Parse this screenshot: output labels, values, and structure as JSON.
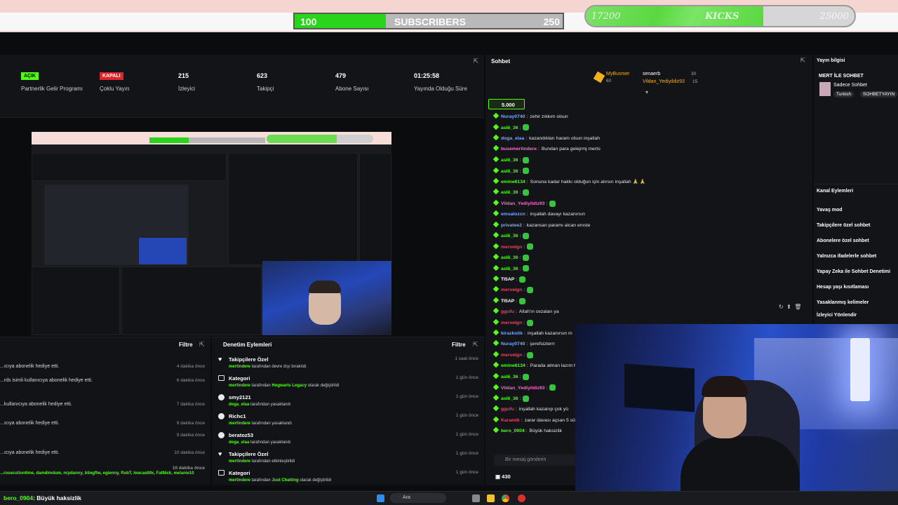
{
  "overlay": {
    "subscribers": {
      "label": "SUBSCRIBERS",
      "current": "100",
      "goal": "250",
      "progress": 0.34
    },
    "kicks": {
      "label": "KICKS",
      "current": "17200",
      "goal": "25000",
      "progress": 0.66
    }
  },
  "stats": [
    {
      "badge": "AÇIK",
      "badge_color": "#53fc18",
      "label": "Partnerlik Gelir Programı"
    },
    {
      "badge": "KAPALI",
      "badge_color": "#e0242b",
      "label": "Çoklu Yayın"
    },
    {
      "value": "215",
      "label": "İzleyici"
    },
    {
      "value": "623",
      "label": "Takipçi"
    },
    {
      "value": "479",
      "label": "Abone Sayısı"
    },
    {
      "value": "01:25:58",
      "label": "Yayında Olduğu Süre"
    }
  ],
  "events_panel": {
    "filter_label": "Filtre",
    "rows": [
      {
        "text": "...ıcıya abonelik hediye etti.",
        "time": "4 dakika önce"
      },
      {
        "text": "...rds isimli kullanıcıya abonelik hediye etti.",
        "time": "6 dakika önce"
      },
      {
        "text": "...kullanıcıya abonelik hediye etti.",
        "time": "7 dakika önce"
      },
      {
        "text": "...ıcıya abonelik hediye etti.",
        "time": "9 dakika önce"
      },
      {
        "text": "",
        "time": "9 dakika önce"
      },
      {
        "text": "...ıcıya abonelik hediye etti.",
        "time": "10 dakika önce"
      },
      {
        "text": "...rosecutiontime, damdimdum, nrpdanny, blingftw, egienny, RobT, loucas69x, FatNick, melanie10",
        "time": "10 dakika önce"
      }
    ]
  },
  "moderation_panel": {
    "title": "Denetim Eylemleri",
    "filter_label": "Filtre",
    "actions": [
      {
        "title": "Takipçilere Özel",
        "user": "mertindere",
        "rest": " tarafından devre dışı bırakıldı",
        "time": "1 saat önce"
      },
      {
        "title": "Kategori",
        "user": "mertindere",
        "mid": " tarafından ",
        "highlight": "Hogwarts Legacy",
        "rest": " olarak değiştirildi",
        "time": "1 gün önce"
      },
      {
        "title": "smy2121",
        "user": "doga_elaa",
        "rest": " tarafından yasaklandı",
        "time": "1 gün önce"
      },
      {
        "title": "Richc1",
        "user": "mertindere",
        "rest": " tarafından yasaklandı",
        "time": "1 gün önce"
      },
      {
        "title": "beratoz53",
        "user": "doga_elaa",
        "rest": " tarafından yasaklandı",
        "time": "1 gün önce"
      },
      {
        "title": "Takipçilere Özel",
        "user": "mertindere",
        "rest": " tarafından etkinleştirildi",
        "time": "1 gün önce"
      },
      {
        "title": "Kategori",
        "user": "mertindere",
        "mid": " tarafından ",
        "highlight": "Just Chatting",
        "rest": " olarak değiştirildi",
        "time": "1 gün önce"
      }
    ]
  },
  "chat": {
    "title": "Sohbet",
    "leaders": [
      {
        "name": "MyBusmer",
        "value": "60"
      },
      {
        "name": "senaerb",
        "value": "30"
      },
      {
        "name": "Vildan_Yediyildiz93",
        "value": "15"
      }
    ],
    "pinned_amount": "5.000",
    "messages": [
      {
        "user": "Nuray0740",
        "color": "#7aa8ff",
        "text": "zehir zıkkım olsun"
      },
      {
        "user": "aslii_36",
        "color": "#53fc18",
        "text": "",
        "emote": true
      },
      {
        "user": "doga_elaa",
        "color": "#7aa8ff",
        "text": "kazandıkları haram olsun inşallah"
      },
      {
        "user": "busemertindere",
        "color": "#ff6bd0",
        "text": "Bundan para gelejrmj merto"
      },
      {
        "user": "aslii_36",
        "color": "#53fc18",
        "text": "",
        "emote": true
      },
      {
        "user": "aslii_36",
        "color": "#53fc18",
        "text": "",
        "emote": true
      },
      {
        "user": "emine6134",
        "color": "#53fc18",
        "text": "Sonuna kadar hakkı olduğun için alırsın inşallah 🙏 🙏"
      },
      {
        "user": "aslii_36",
        "color": "#53fc18",
        "text": "",
        "emote": true
      },
      {
        "user": "Vildan_Yediyildiz93",
        "color": "#ff66cc",
        "text": "",
        "emote": true
      },
      {
        "user": "emsalozcn",
        "color": "#7aa8ff",
        "text": "inşallah davayı kazanırsın"
      },
      {
        "user": "privatee2",
        "color": "#7aa8ff",
        "text": "kazansan paramı alcan enıste"
      },
      {
        "user": "aslii_36",
        "color": "#53fc18",
        "text": "",
        "emote": true
      },
      {
        "user": "mervelgn",
        "color": "#ff3b5c",
        "text": "",
        "emote": true
      },
      {
        "user": "aslii_36",
        "color": "#53fc18",
        "text": "",
        "emote": true
      },
      {
        "user": "aslii_36",
        "color": "#53fc18",
        "text": "",
        "emote": true
      },
      {
        "user": "TI5AP",
        "color": "#ffffff",
        "text": "",
        "emote": true
      },
      {
        "user": "mervelgn",
        "color": "#ff3b5c",
        "text": "",
        "emote": true
      },
      {
        "user": "TI5AP",
        "color": "#ffffff",
        "text": "",
        "emote": true
      },
      {
        "user": "ggufu",
        "color": "#ff3b5c",
        "text": "Allah'ın cezaları ya"
      },
      {
        "user": "mervelgn",
        "color": "#ff3b5c",
        "text": "",
        "emote": true
      },
      {
        "user": "kirazkolik",
        "color": "#7aa8ff",
        "text": "inşallah kazanırsın m"
      },
      {
        "user": "Nuray0740",
        "color": "#7aa8ff",
        "text": "şerefsizlerrr"
      },
      {
        "user": "mervelgn",
        "color": "#ff3b5c",
        "text": "",
        "emote": true
      },
      {
        "user": "emine6134",
        "color": "#53fc18",
        "text": "Parada alman lazım ha"
      },
      {
        "user": "aslii_36",
        "color": "#53fc18",
        "text": "",
        "emote": true
      },
      {
        "user": "Vildan_Yediyildiz93",
        "color": "#ff66cc",
        "text": "",
        "emote": true
      },
      {
        "user": "aslii_36",
        "color": "#53fc18",
        "text": "",
        "emote": true
      },
      {
        "user": "ggufu",
        "color": "#ff3b5c",
        "text": "inşallah kazanıp çok yü"
      },
      {
        "user": "Karamlk",
        "color": "#ff3b5c",
        "text": "zarar davası açsan 5 süs"
      },
      {
        "user": "bero_0904",
        "color": "#53fc18",
        "text": "Büyük haksizlik"
      }
    ],
    "input_placeholder": "Bir mesaj gönderin",
    "viewer_count": "430"
  },
  "stream_info": {
    "title": "Yayın bilgisi",
    "stream_title": "MERT İLE SOHBET",
    "mode": "Sadece Sohbet",
    "tags": [
      "Turkish",
      "SOHBETYAYIN"
    ]
  },
  "channel_actions": {
    "title": "Kanal Eylemleri",
    "items": [
      "Yavaş mod",
      "Takipçilere özel sohbet",
      "Abonelere özel sohbet",
      "Yalnızca ifadelerle sohbet",
      "Yapay Zeka ile Sohbet Denetimi",
      "Hesap yaşı kısıtlaması",
      "Yasaklanmış kelimeler",
      "İzleyici Yönlendir"
    ]
  },
  "taskbar": {
    "title_user": "bero_0904",
    "title_text": ": Büyük haksizlik",
    "search": "Ara"
  }
}
